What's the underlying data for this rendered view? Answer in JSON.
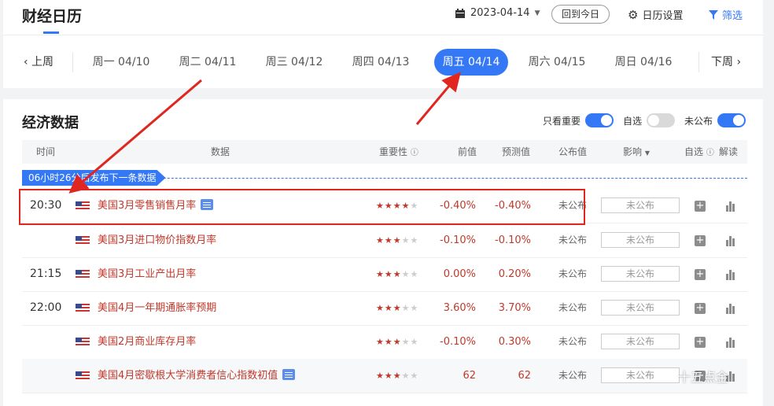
{
  "header": {
    "title": "财经日历",
    "date": "2023-04-14",
    "today_label": "回到今日",
    "settings_label": "日历设置",
    "filter_label": "筛选"
  },
  "nav": {
    "prev_label": "上周",
    "next_label": "下周",
    "days": [
      {
        "label": "周一 04/10",
        "active": false
      },
      {
        "label": "周二 04/11",
        "active": false
      },
      {
        "label": "周三 04/12",
        "active": false
      },
      {
        "label": "周四 04/13",
        "active": false
      },
      {
        "label": "周五 04/14",
        "active": true
      },
      {
        "label": "周六 04/15",
        "active": false
      },
      {
        "label": "周日 04/16",
        "active": false
      }
    ]
  },
  "section": {
    "title": "经济数据",
    "toggles": [
      {
        "label": "只看重要",
        "on": true
      },
      {
        "label": "自选",
        "on": false
      },
      {
        "label": "未公布",
        "on": true
      }
    ]
  },
  "table": {
    "headers": {
      "time": "时间",
      "data": "数据",
      "importance": "重要性",
      "previous": "前值",
      "forecast": "预测值",
      "actual": "公布值",
      "impact": "影响",
      "watch": "自选",
      "explain": "解读"
    },
    "countdown": "06小时26分后发布下一条数据",
    "rows": [
      {
        "time": "20:30",
        "name": "美国3月零售销售月率",
        "stars": 4,
        "previous": "-0.40%",
        "forecast": "-0.40%",
        "actual": "未公布",
        "impact": "未公布",
        "has_doc": true
      },
      {
        "time": "",
        "name": "美国3月进口物价指数月率",
        "stars": 3,
        "previous": "-0.10%",
        "forecast": "-0.10%",
        "actual": "未公布",
        "impact": "未公布",
        "has_doc": false
      },
      {
        "time": "21:15",
        "name": "美国3月工业产出月率",
        "stars": 3,
        "previous": "0.00%",
        "forecast": "0.20%",
        "actual": "未公布",
        "impact": "未公布",
        "has_doc": false
      },
      {
        "time": "22:00",
        "name": "美国4月一年期通胀率预期",
        "stars": 3,
        "previous": "3.60%",
        "forecast": "3.70%",
        "actual": "未公布",
        "impact": "未公布",
        "has_doc": false
      },
      {
        "time": "",
        "name": "美国2月商业库存月率",
        "stars": 3,
        "previous": "-0.10%",
        "forecast": "0.30%",
        "actual": "未公布",
        "impact": "未公布",
        "has_doc": false
      },
      {
        "time": "",
        "name": "美国4月密歇根大学消费者信心指数初值",
        "stars": 3,
        "previous": "62",
        "forecast": "62",
        "actual": "未公布",
        "impact": "未公布",
        "has_doc": true
      }
    ]
  },
  "watermark": "十五点金"
}
